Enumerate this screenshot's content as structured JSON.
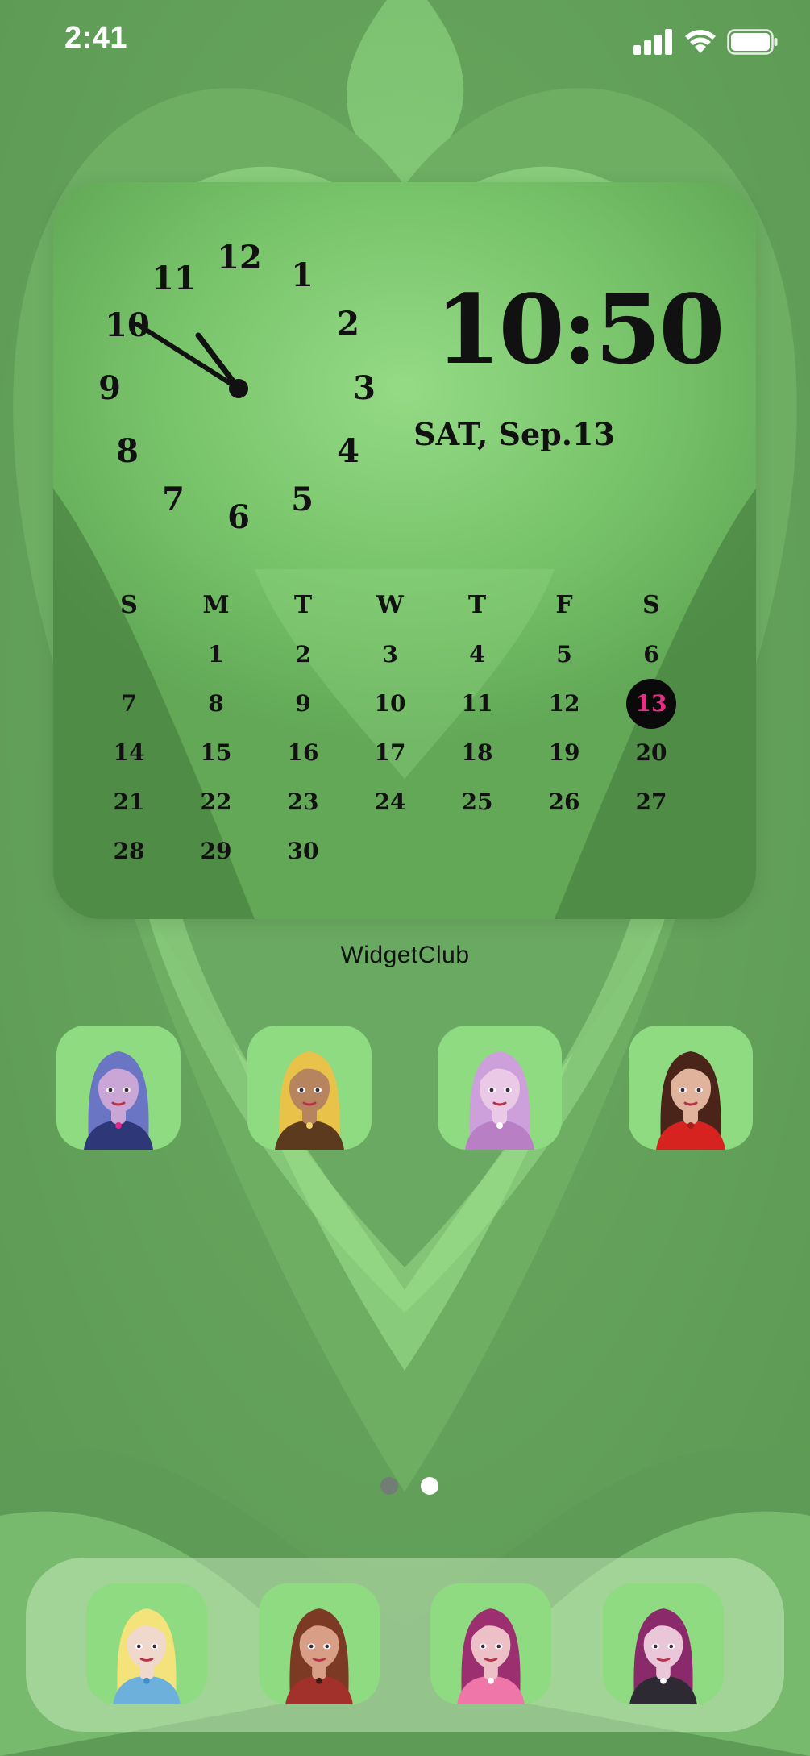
{
  "status_bar": {
    "time": "2:41",
    "icons": [
      "signal-icon",
      "wifi-icon",
      "battery-icon"
    ]
  },
  "widget": {
    "analog_clock_numbers": [
      "12",
      "1",
      "2",
      "3",
      "4",
      "5",
      "6",
      "7",
      "8",
      "9",
      "10",
      "11"
    ],
    "digital_time": "10:50",
    "date": "SAT, Sep.13",
    "calendar": {
      "weekdays": [
        "S",
        "M",
        "T",
        "W",
        "T",
        "F",
        "S"
      ],
      "weeks": [
        [
          "",
          "1",
          "2",
          "3",
          "4",
          "5",
          "6"
        ],
        [
          "7",
          "8",
          "9",
          "10",
          "11",
          "12",
          "13"
        ],
        [
          "14",
          "15",
          "16",
          "17",
          "18",
          "19",
          "20"
        ],
        [
          "21",
          "22",
          "23",
          "24",
          "25",
          "26",
          "27"
        ],
        [
          "28",
          "29",
          "30",
          "",
          "",
          "",
          ""
        ]
      ],
      "today": "13"
    },
    "label": "WidgetClub"
  },
  "home_icons": [
    {
      "name": "avatar-periwinkle-hair",
      "hair": "#6a76c4",
      "skin": "#c9a6d6",
      "shirt": "#2e3778",
      "accent": "#e0288a"
    },
    {
      "name": "avatar-blonde-hair",
      "hair": "#e9c24a",
      "skin": "#b78460",
      "shirt": "#5b3a1e",
      "accent": "#f2d36b"
    },
    {
      "name": "avatar-lilac-hair",
      "hair": "#cda0dc",
      "skin": "#e9c9e6",
      "shirt": "#b87fc4",
      "accent": "#ffffff"
    },
    {
      "name": "avatar-brunette-hair",
      "hair": "#4a2418",
      "skin": "#e0b49c",
      "shirt": "#d6231f",
      "accent": "#a62218"
    }
  ],
  "page_indicator": {
    "count": 2,
    "active": 1
  },
  "dock_icons": [
    {
      "name": "avatar-light-blonde",
      "hair": "#f4e27a",
      "skin": "#f1d8cc",
      "shirt": "#6eb0dc",
      "accent": "#3f8fc9"
    },
    {
      "name": "avatar-auburn",
      "hair": "#7c3a24",
      "skin": "#d89f86",
      "shirt": "#a1312a",
      "accent": "#3b1b12"
    },
    {
      "name": "avatar-magenta-bob",
      "hair": "#9c2f6f",
      "skin": "#edc0c8",
      "shirt": "#ef76a8",
      "accent": "#ffffff"
    },
    {
      "name": "avatar-plum-hair",
      "hair": "#8a2a6a",
      "skin": "#e9c6d8",
      "shirt": "#2d2a33",
      "accent": "#ffffff"
    }
  ],
  "colors": {
    "wallpaper_light": "#8fd681",
    "wallpaper_dark": "#4c7f45",
    "today_highlight_bg": "#0a0a0a",
    "today_highlight_text": "#e62e84"
  }
}
